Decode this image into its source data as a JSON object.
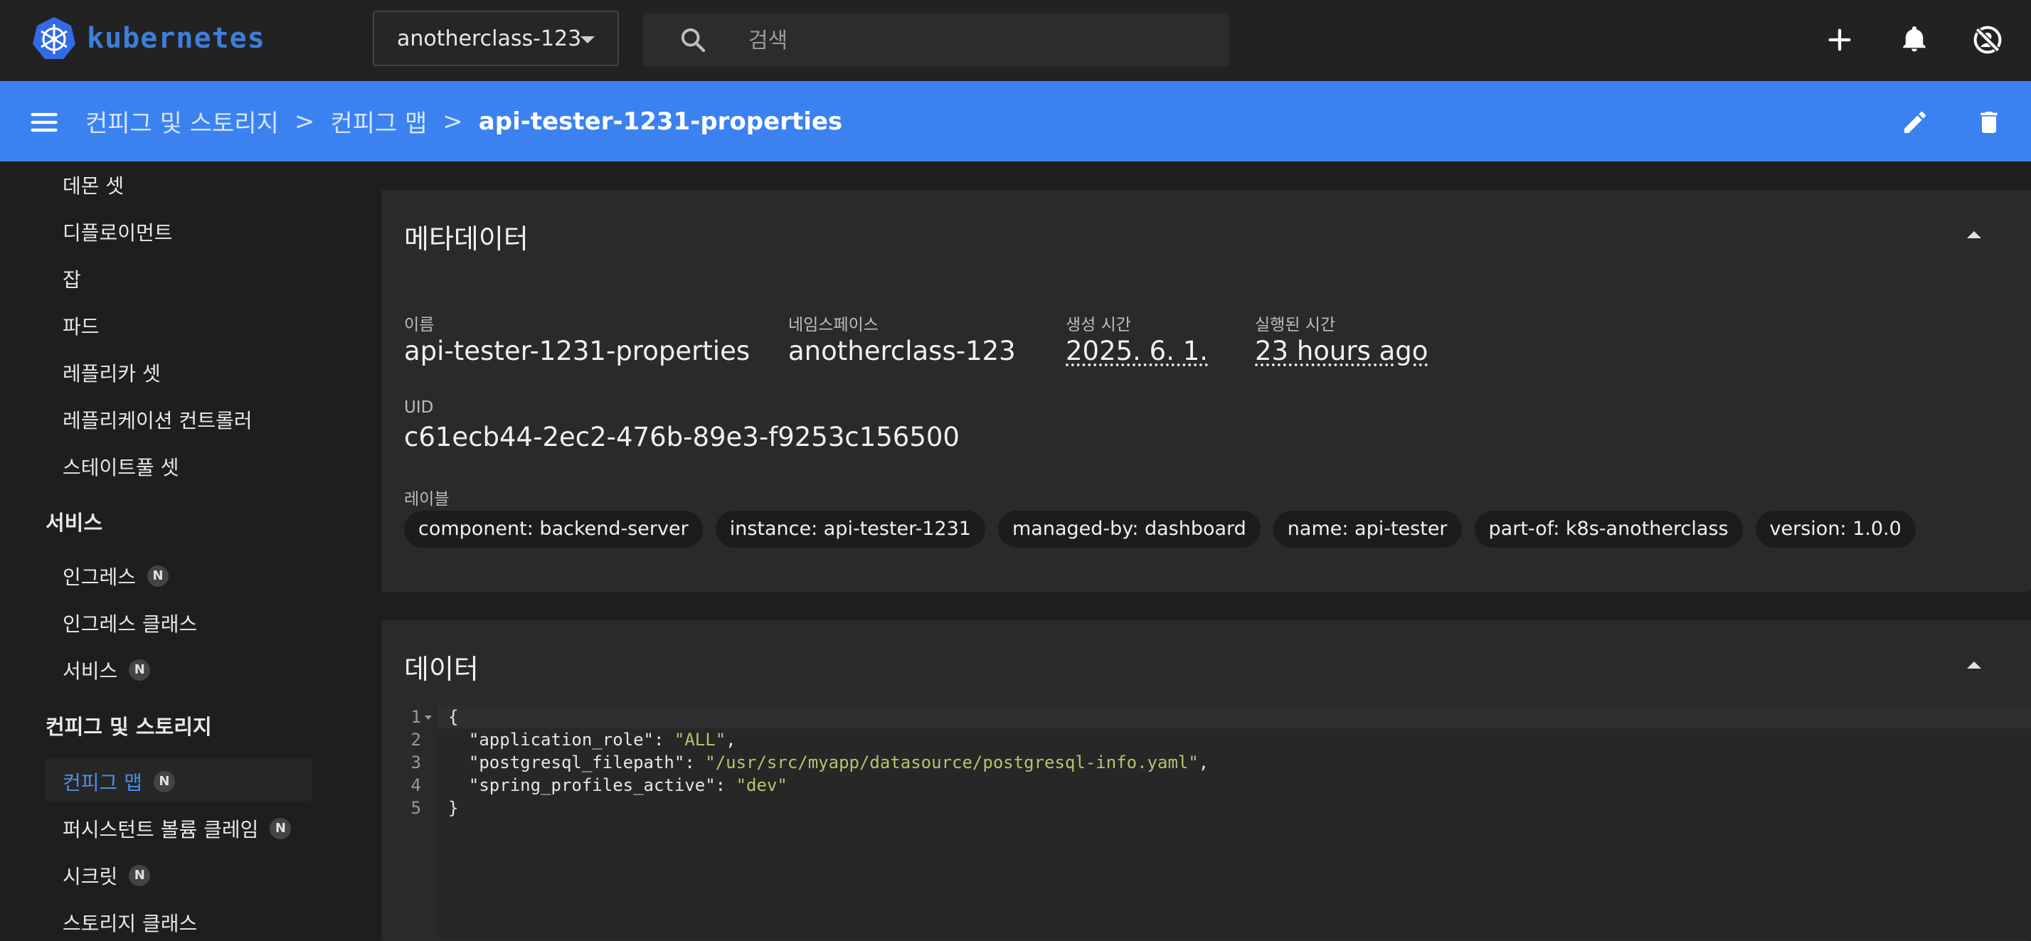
{
  "app": {
    "logo_text": "kubernetes"
  },
  "topbar": {
    "namespace": "anotherclass-123",
    "search_placeholder": "검색"
  },
  "breadcrumb": {
    "items": [
      "컨피그 및 스토리지",
      "컨피그 맵"
    ],
    "current": "api-tester-1231-properties",
    "separator": ">"
  },
  "sidebar": {
    "workloads": [
      "데몬 셋",
      "디플로이먼트",
      "잡",
      "파드",
      "레플리카 셋",
      "레플리케이션 컨트롤러",
      "스테이트풀 셋"
    ],
    "service_group": "서비스",
    "services": [
      {
        "label": "인그레스",
        "badge": "N"
      },
      {
        "label": "인그레스 클래스",
        "badge": ""
      },
      {
        "label": "서비스",
        "badge": "N"
      }
    ],
    "config_group": "컨피그 및 스토리지",
    "config": [
      {
        "label": "컨피그 맵",
        "badge": "N"
      },
      {
        "label": "퍼시스턴트 볼륨 클레임",
        "badge": "N"
      },
      {
        "label": "시크릿",
        "badge": "N"
      },
      {
        "label": "스토리지 클래스",
        "badge": ""
      }
    ]
  },
  "metadata": {
    "title": "메타데이터",
    "name_label": "이름",
    "name": "api-tester-1231-properties",
    "namespace_label": "네임스페이스",
    "namespace": "anotherclass-123",
    "created_label": "생성 시간",
    "created": "2025. 6. 1.",
    "age_label": "실행된 시간",
    "age": "23 hours ago",
    "uid_label": "UID",
    "uid": "c61ecb44-2ec2-476b-89e3-f9253c156500",
    "labels_label": "레이블",
    "labels": [
      "component: backend-server",
      "instance: api-tester-1231",
      "managed-by: dashboard",
      "name: api-tester",
      "part-of: k8s-anotherclass",
      "version: 1.0.0"
    ]
  },
  "data_section": {
    "title": "데이터",
    "lines": [
      {
        "num": "1",
        "key": "",
        "value": "",
        "raw": "{"
      },
      {
        "num": "2",
        "key": "  \"application_role\": ",
        "value": "\"ALL\"",
        "tail": ","
      },
      {
        "num": "3",
        "key": "  \"postgresql_filepath\": ",
        "value": "\"/usr/src/myapp/datasource/postgresql-info.yaml\"",
        "tail": ","
      },
      {
        "num": "4",
        "key": "  \"spring_profiles_active\": ",
        "value": "\"dev\"",
        "tail": ""
      },
      {
        "num": "5",
        "key": "",
        "value": "",
        "raw": "}"
      }
    ]
  },
  "colors": {
    "accent": "#3b82f0",
    "active_nav": "#4a90e2",
    "string": "#b5c46a"
  }
}
